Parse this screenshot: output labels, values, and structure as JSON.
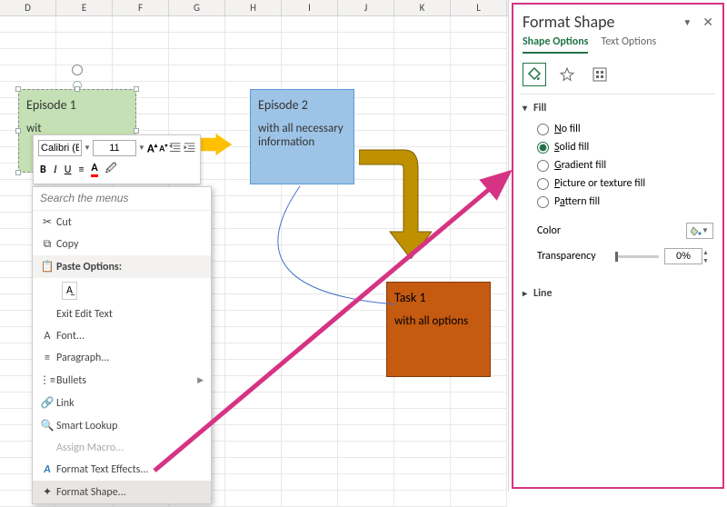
{
  "columns": [
    "D",
    "E",
    "F",
    "G",
    "H",
    "I",
    "J",
    "K",
    "L"
  ],
  "shapes": {
    "ep1": {
      "title": "Episode 1",
      "subtitle": "wit"
    },
    "ep2": {
      "title": "Episode 2",
      "subtitle": "with all necessary information"
    },
    "task1": {
      "title": "Task 1",
      "subtitle": "with all options"
    }
  },
  "mini_toolbar": {
    "font_name": "Calibri (E",
    "font_size": "11"
  },
  "context_menu": {
    "search_placeholder": "Search the menus",
    "items": {
      "cut": "Cut",
      "copy": "Copy",
      "paste_options": "Paste Options:",
      "exit_edit": "Exit Edit Text",
      "font": "Font...",
      "paragraph": "Paragraph...",
      "bullets": "Bullets",
      "link": "Link",
      "smart_lookup": "Smart Lookup",
      "assign_macro": "Assign Macro...",
      "format_text_effects": "Format Text Effects...",
      "format_shape": "Format Shape..."
    }
  },
  "pane": {
    "title": "Format Shape",
    "tabs": {
      "shape": "Shape Options",
      "text": "Text Options"
    },
    "sections": {
      "fill": "Fill",
      "line": "Line"
    },
    "fill_options": {
      "no_fill": "No fill",
      "solid_fill": "Solid fill",
      "gradient_fill": "Gradient fill",
      "picture_fill": "Picture or texture fill",
      "pattern_fill": "Pattern fill"
    },
    "color_label": "Color",
    "transparency_label": "Transparency",
    "transparency_value": "0%"
  }
}
